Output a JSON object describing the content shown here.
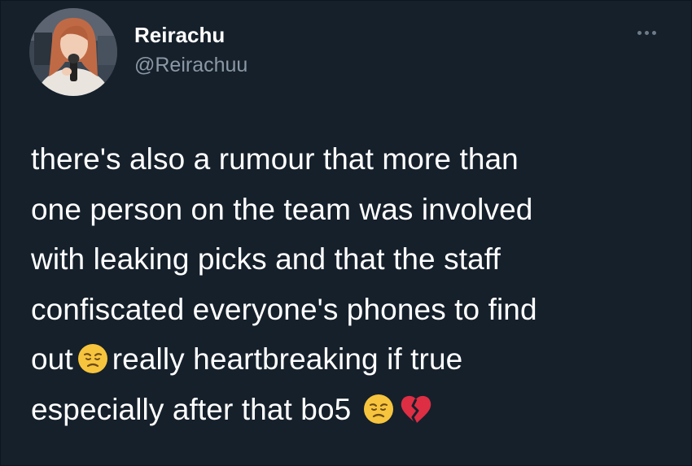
{
  "tweet": {
    "display_name": "Reirachu",
    "handle": "@Reirachuu",
    "more_icon": "more-horizontal-icon",
    "text_lines": [
      "there's also a rumour that more than",
      "one person on the team was involved",
      "with leaking picks and that the staff",
      "confiscated everyone's phones to find"
    ],
    "line5_before": "out",
    "line5_after": "really heartbreaking if true",
    "line6": "especially after that bo5",
    "emojis": {
      "disappointed": "disappointed-face-emoji",
      "broken_heart": "broken-heart-emoji"
    }
  },
  "colors": {
    "background": "#15202b",
    "primary_text": "#ffffff",
    "secondary_text": "#8b98a5",
    "emoji_face": "#f7c43d",
    "broken_heart": "#dd2e44"
  }
}
